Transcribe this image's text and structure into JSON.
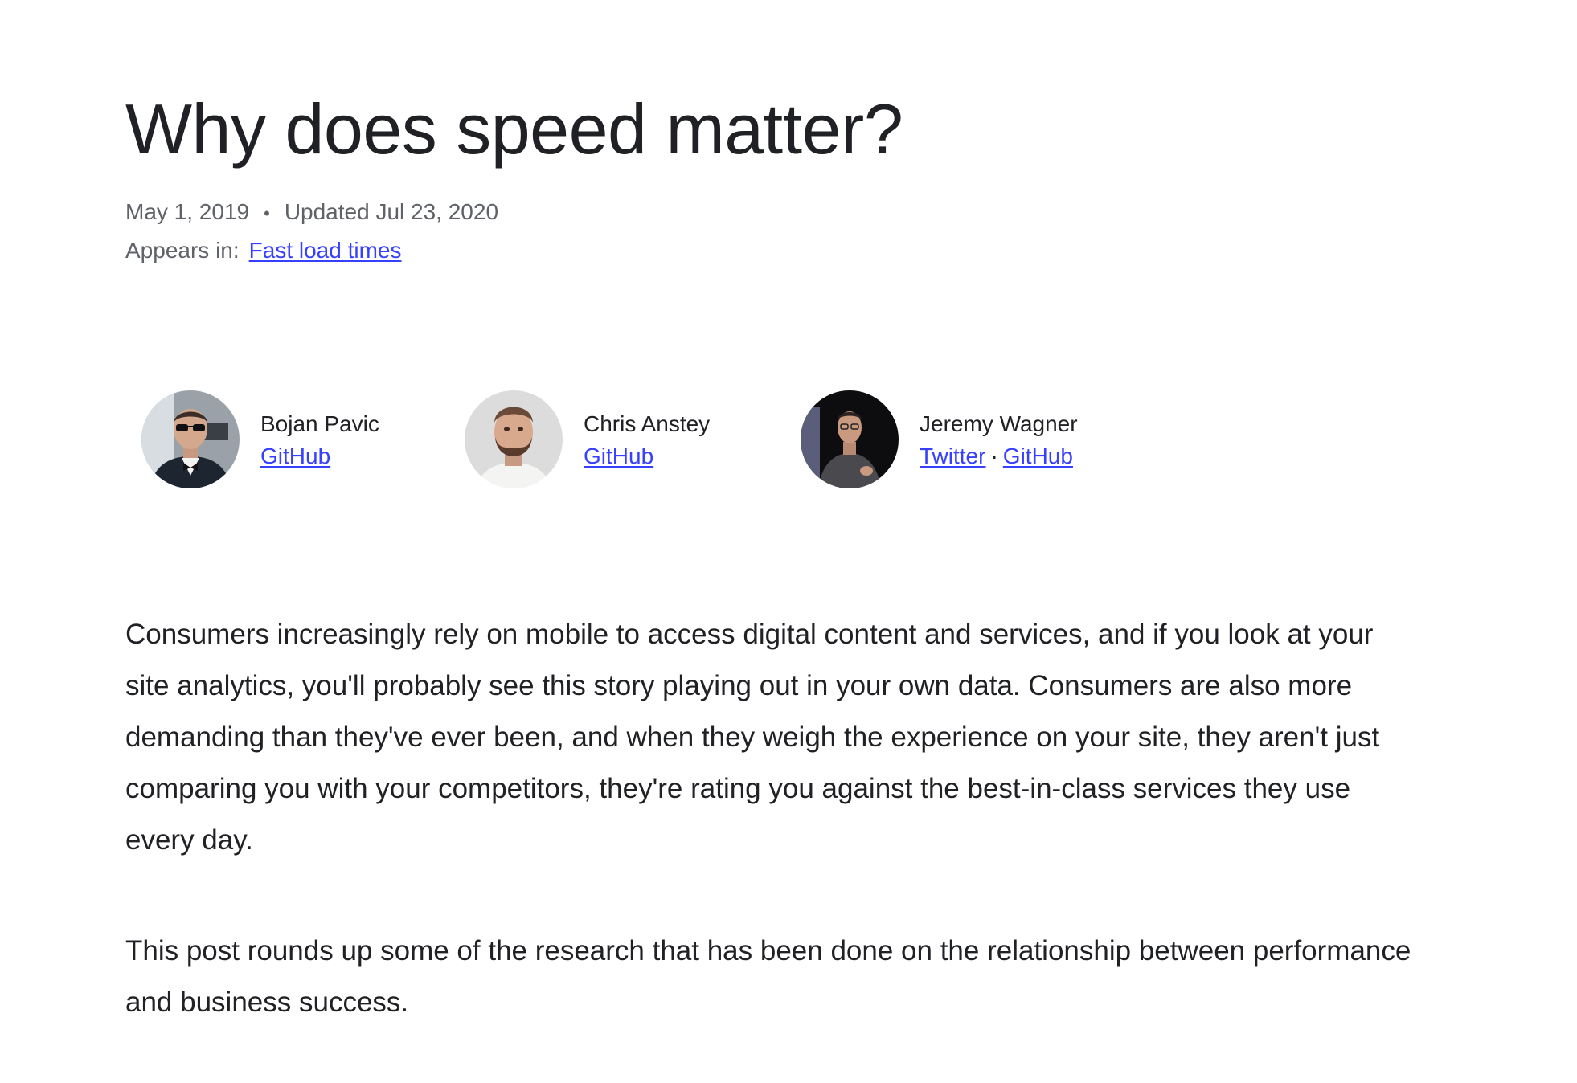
{
  "article": {
    "title": "Why does speed matter?",
    "date_published": "May 1, 2019",
    "date_updated": "Updated Jul 23, 2020",
    "appears_in_label": "Appears in:",
    "appears_in_link": "Fast load times"
  },
  "authors": [
    {
      "name": "Bojan Pavic",
      "links": [
        {
          "label": "GitHub"
        }
      ]
    },
    {
      "name": "Chris Anstey",
      "links": [
        {
          "label": "GitHub"
        }
      ]
    },
    {
      "name": "Jeremy Wagner",
      "links": [
        {
          "label": "Twitter"
        },
        {
          "label": "GitHub"
        }
      ],
      "link_separator": "·"
    }
  ],
  "paragraphs": [
    "Consumers increasingly rely on mobile to access digital content and services, and if you look at your site analytics, you'll probably see this story playing out in your own data. Consumers are also more demanding than they've ever been, and when they weigh the experience on your site, they aren't just comparing you with your competitors, they're rating you against the best-in-class services they use every day.",
    "This post rounds up some of the research that has been done on the relationship between performance and business success."
  ],
  "colors": {
    "link": "#3740ff",
    "text": "#202124",
    "meta": "#5f6368"
  }
}
